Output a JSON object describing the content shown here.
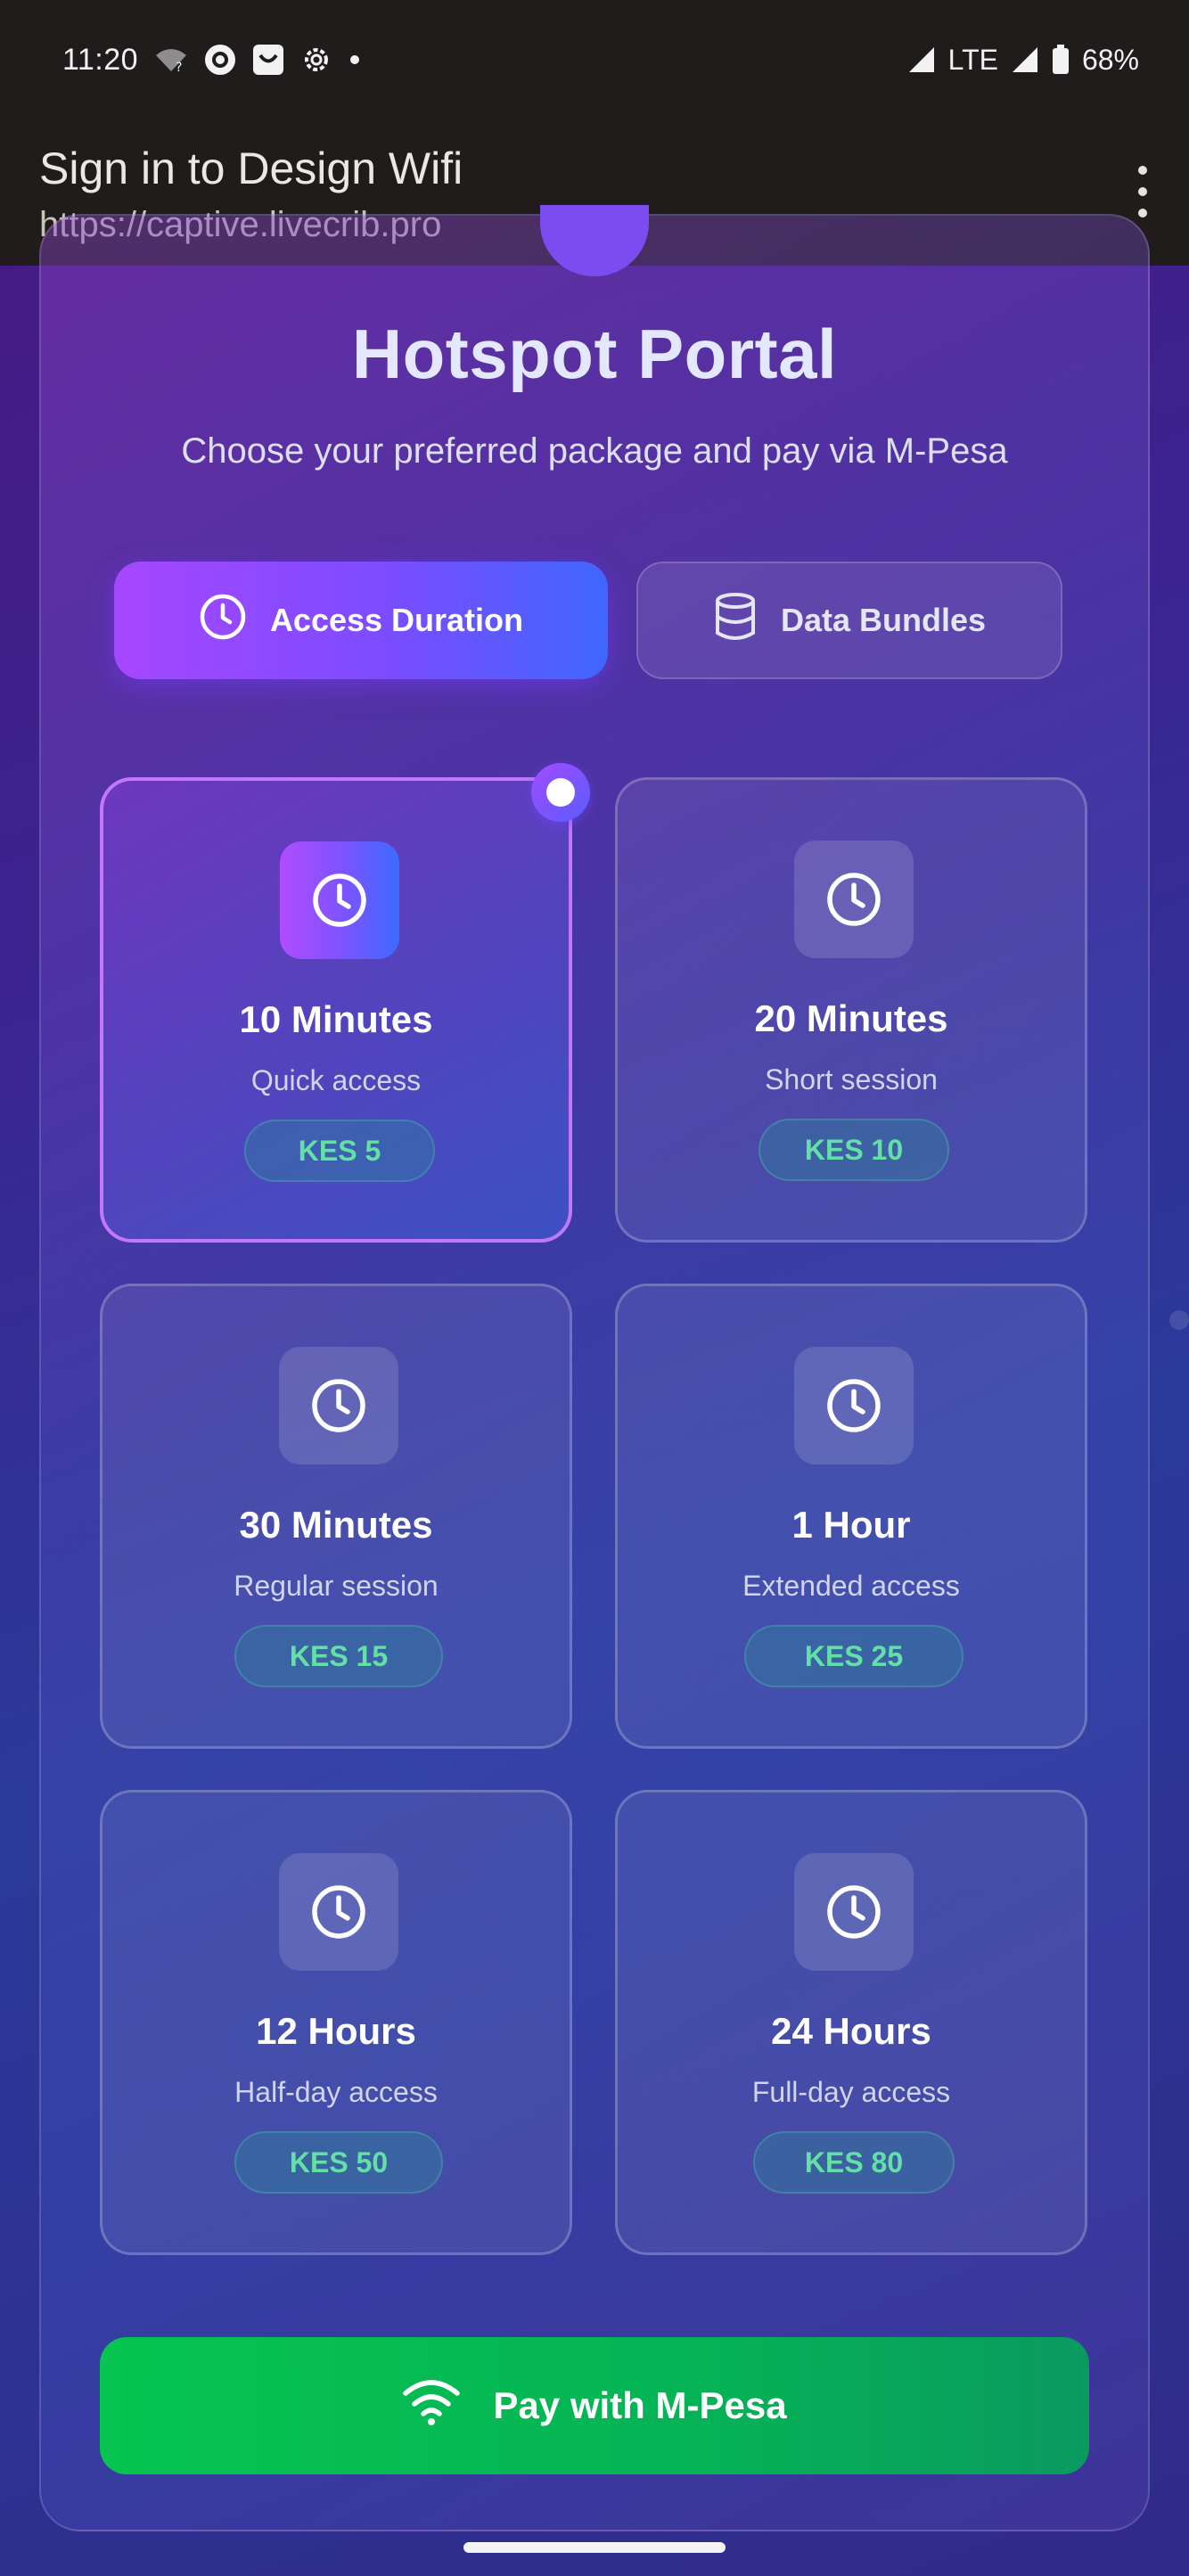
{
  "status_bar": {
    "time": "11:20",
    "network": "LTE",
    "battery": "68%",
    "icons": [
      "wifi-question-icon",
      "circle-o-icon",
      "smile-box-icon",
      "settings-icon",
      "dot-icon",
      "signal-icon",
      "battery-icon"
    ]
  },
  "browser": {
    "title": "Sign in to Design Wifi",
    "url": "https://captive.livecrib.pro",
    "menu_icon": "more-vert-icon"
  },
  "portal": {
    "title": "Hotspot Portal",
    "subtitle": "Choose your preferred package and pay via M-Pesa"
  },
  "tabs": [
    {
      "label": "Access Duration",
      "icon": "clock-icon",
      "active": true
    },
    {
      "label": "Data Bundles",
      "icon": "database-icon",
      "active": false
    }
  ],
  "packages": [
    {
      "name": "10 Minutes",
      "desc": "Quick access",
      "price": "KES 5",
      "selected": true
    },
    {
      "name": "20 Minutes",
      "desc": "Short session",
      "price": "KES 10",
      "selected": false
    },
    {
      "name": "30 Minutes",
      "desc": "Regular session",
      "price": "KES 15",
      "selected": false
    },
    {
      "name": "1 Hour",
      "desc": "Extended access",
      "price": "KES 25",
      "selected": false
    },
    {
      "name": "12 Hours",
      "desc": "Half-day access",
      "price": "KES 50",
      "selected": false
    },
    {
      "name": "24 Hours",
      "desc": "Full-day access",
      "price": "KES 80",
      "selected": false
    }
  ],
  "pay_button": {
    "label": "Pay with M-Pesa",
    "icon": "wifi-icon"
  },
  "colors": {
    "accent_purple": "#a647ff",
    "accent_blue": "#3f66ff",
    "price_green": "#62e0a6",
    "pay_green": "#06c44f"
  }
}
